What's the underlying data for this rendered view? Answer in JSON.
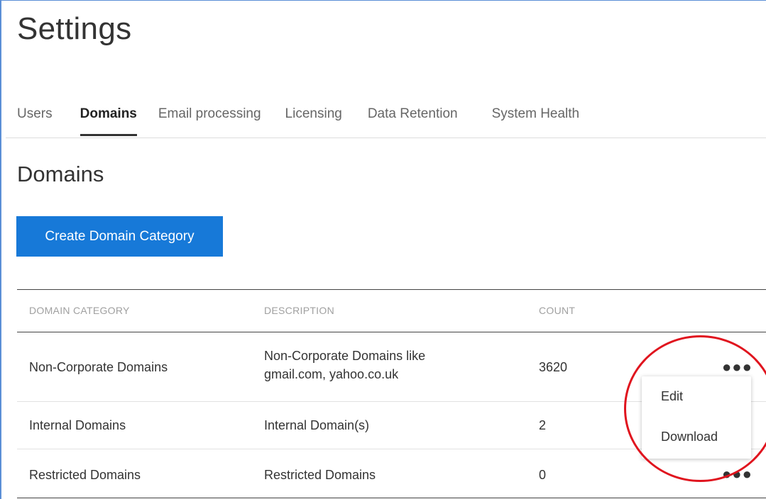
{
  "page": {
    "title": "Settings"
  },
  "tabs": [
    {
      "label": "Users",
      "active": false
    },
    {
      "label": "Domains",
      "active": true
    },
    {
      "label": "Email processing",
      "active": false
    },
    {
      "label": "Licensing",
      "active": false
    },
    {
      "label": "Data Retention",
      "active": false
    },
    {
      "label": "System Health",
      "active": false
    }
  ],
  "section": {
    "title": "Domains",
    "create_button_label": "Create Domain Category"
  },
  "table": {
    "headers": [
      "DOMAIN CATEGORY",
      "DESCRIPTION",
      "COUNT"
    ],
    "rows": [
      {
        "category": "Non-Corporate Domains",
        "description_line1": "Non-Corporate Domains like",
        "description_line2": "gmail.com, yahoo.co.uk",
        "count": "3620"
      },
      {
        "category": "Internal Domains",
        "description": "Internal Domain(s)",
        "count": "2"
      },
      {
        "category": "Restricted Domains",
        "description": "Restricted Domains",
        "count": "0"
      }
    ],
    "more_icon": "more-horizontal-icon"
  },
  "context_menu": {
    "items": [
      "Edit",
      "Download"
    ]
  },
  "colors": {
    "primary_button": "#1779d8",
    "highlight_circle": "#e0141e",
    "frame": "#5b8fd6"
  }
}
